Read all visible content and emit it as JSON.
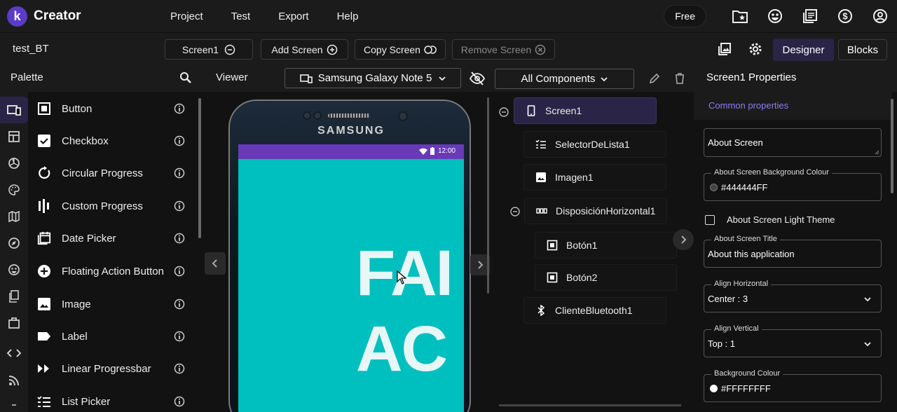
{
  "app": {
    "logo_letter": "k",
    "name": "Creator"
  },
  "top_menu": [
    "Project",
    "Test",
    "Export",
    "Help"
  ],
  "top_right": {
    "free_label": "Free",
    "icons": [
      "folder-star-icon",
      "emoji-icon",
      "library-icon",
      "dollar-icon",
      "account-icon"
    ]
  },
  "toolbar": {
    "project_name": "test_BT",
    "screen_select": "Screen1",
    "add_screen": "Add Screen",
    "copy_screen": "Copy Screen",
    "remove_screen": "Remove Screen",
    "designer": "Designer",
    "blocks": "Blocks"
  },
  "palette": {
    "title": "Palette",
    "items": [
      {
        "label": "Button",
        "icon": "button-icon"
      },
      {
        "label": "Checkbox",
        "icon": "checkbox-icon"
      },
      {
        "label": "Circular Progress",
        "icon": "circular-progress-icon"
      },
      {
        "label": "Custom Progress",
        "icon": "custom-progress-icon"
      },
      {
        "label": "Date Picker",
        "icon": "date-picker-icon"
      },
      {
        "label": "Floating Action Button",
        "icon": "fab-icon"
      },
      {
        "label": "Image",
        "icon": "image-icon"
      },
      {
        "label": "Label",
        "icon": "label-icon"
      },
      {
        "label": "Linear Progressbar",
        "icon": "linear-progressbar-icon"
      },
      {
        "label": "List Picker",
        "icon": "list-picker-icon"
      }
    ]
  },
  "viewer": {
    "title": "Viewer",
    "device": "Samsung Galaxy Note 5",
    "phone_brand": "SAMSUNG",
    "status_time": "12:00",
    "screen_text_line1": "FAI",
    "screen_text_line2": "AC"
  },
  "components": {
    "filter": "All Components",
    "tree": [
      {
        "label": "Screen1",
        "icon": "phone-icon",
        "level": 0,
        "selected": true
      },
      {
        "label": "SelectorDeLista1",
        "icon": "list-picker-icon",
        "level": 1
      },
      {
        "label": "Imagen1",
        "icon": "image-icon",
        "level": 1
      },
      {
        "label": "DisposiciónHorizontal1",
        "icon": "horizontal-arrangement-icon",
        "level": 1
      },
      {
        "label": "Botón1",
        "icon": "button-icon",
        "level": 2
      },
      {
        "label": "Botón2",
        "icon": "button-icon",
        "level": 2
      },
      {
        "label": "ClienteBluetooth1",
        "icon": "bluetooth-icon",
        "level": 1
      }
    ]
  },
  "properties": {
    "title": "Screen1 Properties",
    "tab": "Common properties",
    "about_screen": "About Screen",
    "bg_colour_label": "About Screen Background Colour",
    "bg_colour_value": "#444444FF",
    "light_theme_label": "About Screen Light Theme",
    "title_label": "About Screen Title",
    "title_value": "About this application",
    "align_h_label": "Align Horizontal",
    "align_h_value": "Center : 3",
    "align_v_label": "Align Vertical",
    "align_v_value": "Top : 1",
    "background_label": "Background Colour",
    "background_value": "#FFFFFFFF"
  },
  "colors": {
    "accent": "#5a3cc6",
    "selected_bg": "#2a2447",
    "status_bar": "#673ab7",
    "screen_bg": "#00bfbf",
    "link": "#8c7df0"
  }
}
